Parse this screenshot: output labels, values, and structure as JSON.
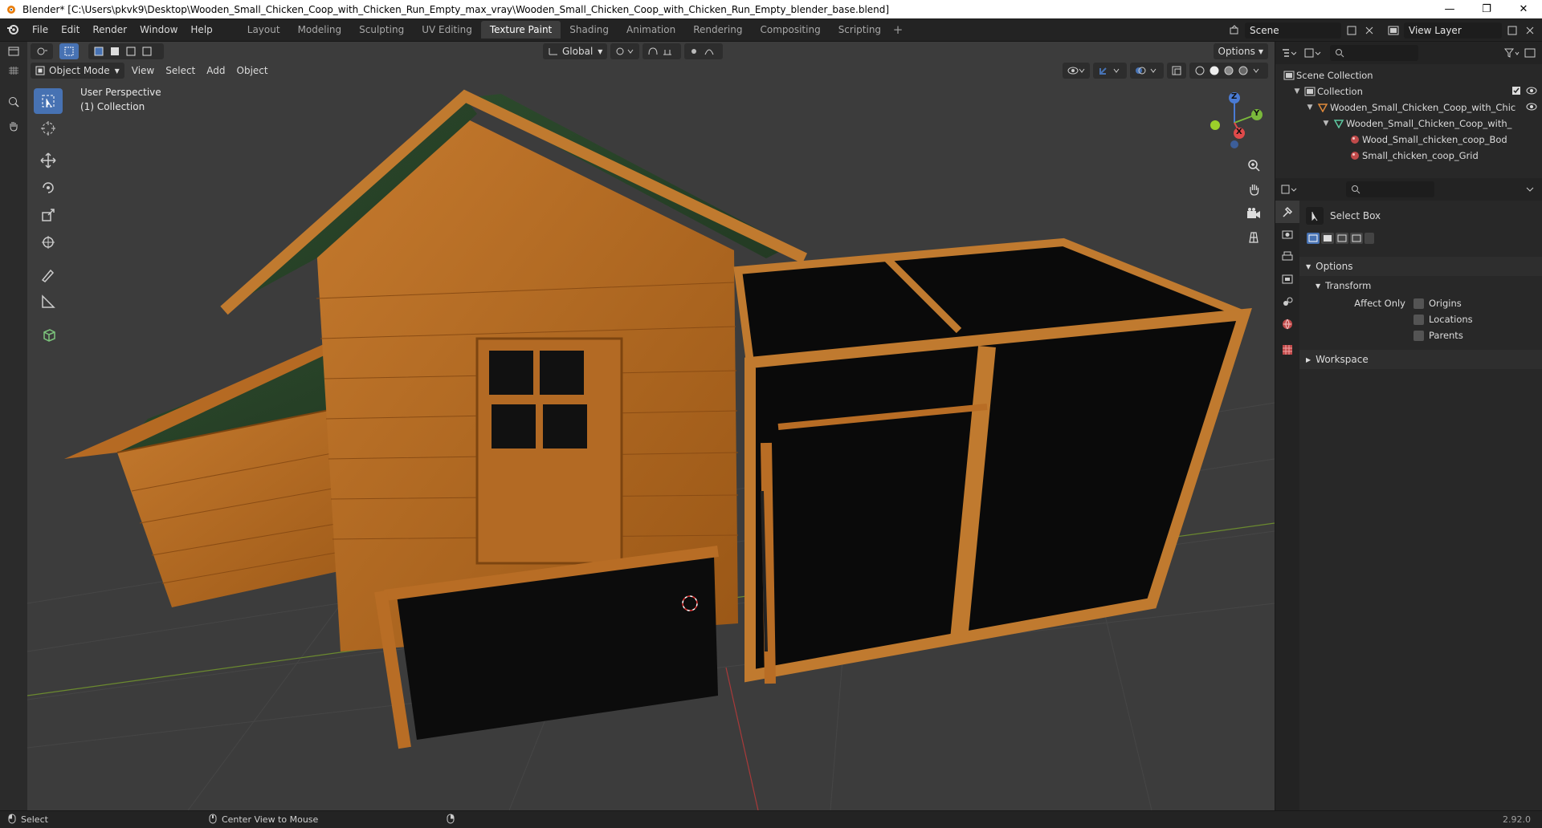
{
  "window": {
    "title": "Blender* [C:\\Users\\pkvk9\\Desktop\\Wooden_Small_Chicken_Coop_with_Chicken_Run_Empty_max_vray\\Wooden_Small_Chicken_Coop_with_Chicken_Run_Empty_blender_base.blend]",
    "minimize": "—",
    "maximize": "❐",
    "close": "✕"
  },
  "menu": {
    "items": [
      "File",
      "Edit",
      "Render",
      "Window",
      "Help"
    ]
  },
  "workspaces": {
    "tabs": [
      "Layout",
      "Modeling",
      "Sculpting",
      "UV Editing",
      "Texture Paint",
      "Shading",
      "Animation",
      "Rendering",
      "Compositing",
      "Scripting"
    ],
    "active": "Texture Paint",
    "add": "+"
  },
  "scene": {
    "name": "Scene",
    "view_layer": "View Layer"
  },
  "viewport": {
    "mode": "Object Mode",
    "menus": [
      "View",
      "Select",
      "Add",
      "Object"
    ],
    "orientation": "Global",
    "options": "Options",
    "overlay_line1": "User Perspective",
    "overlay_line2": "(1) Collection",
    "gizmo": {
      "x": "X",
      "y": "Y",
      "z": "Z"
    }
  },
  "outliner": {
    "rows": [
      {
        "label": "Scene Collection",
        "indent": 0
      },
      {
        "label": "Collection",
        "indent": 1
      },
      {
        "label": "Wooden_Small_Chicken_Coop_with_Chic",
        "indent": 2
      },
      {
        "label": "Wooden_Small_Chicken_Coop_with_",
        "indent": 3
      },
      {
        "label": "Wood_Small_chicken_coop_Bod",
        "indent": 4
      },
      {
        "label": "Small_chicken_coop_Grid",
        "indent": 4
      }
    ]
  },
  "properties": {
    "tool_name": "Select Box",
    "options_label": "Options",
    "transform_label": "Transform",
    "affect_only_label": "Affect Only",
    "checkboxes": [
      "Origins",
      "Locations",
      "Parents"
    ],
    "workspace_label": "Workspace"
  },
  "status": {
    "left": "Select",
    "middle": "Center View to Mouse",
    "version": "2.92.0"
  },
  "colors": {
    "accent": "#4772b3",
    "wood": "#b5651d",
    "roof": "#2f4a2f"
  }
}
